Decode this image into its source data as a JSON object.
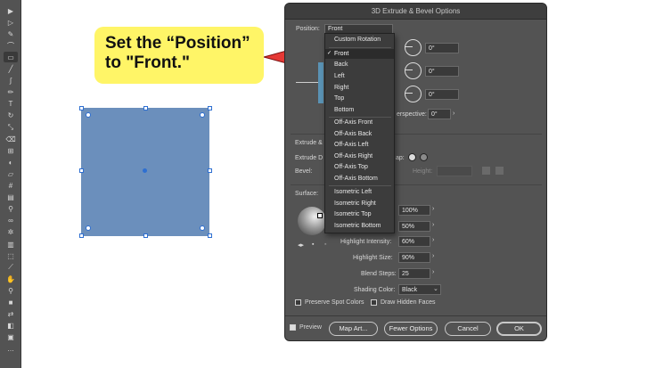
{
  "callout": {
    "line1": "Set the “Position”",
    "line2": "to \"Front.\""
  },
  "colors": {
    "shape_fill": "#6b8fbc",
    "callout_bg": "#fff567",
    "arrow": "#e53935",
    "dialog_bg": "#535353"
  },
  "dialog": {
    "title": "3D Extrude & Bevel Options",
    "position_label": "Position:",
    "position_value": "Front",
    "rotation": [
      "0°",
      "0°",
      "0°"
    ],
    "perspective_label": "erspective:",
    "perspective_value": "0°",
    "extrude_section": "Extrude &",
    "extrude_depth_label": "Extrude D",
    "cap_label": "ap:",
    "bevel_label": "Bevel:",
    "height_label": "Height:",
    "surface_label": "Surface:",
    "light_intensity_value": "100%",
    "ambient_light_value": "50%",
    "highlight_intensity_label": "Highlight Intensity:",
    "highlight_intensity_value": "60%",
    "highlight_size_label": "Highlight Size:",
    "highlight_size_value": "90%",
    "blend_steps_label": "Blend Steps:",
    "blend_steps_value": "25",
    "shading_color_label": "Shading Color:",
    "shading_color_value": "Black",
    "preserve_spot_label": "Preserve Spot Colors",
    "draw_hidden_label": "Draw Hidden Faces",
    "preview_label": "Preview",
    "map_art_label": "Map Art...",
    "fewer_options_label": "Fewer Options",
    "cancel_label": "Cancel",
    "ok_label": "OK"
  },
  "menu": {
    "items_group1": [
      "Custom Rotation"
    ],
    "selected": "Front",
    "items_group2": [
      "Back",
      "Left",
      "Right",
      "Top",
      "Bottom"
    ],
    "items_group3": [
      "Off-Axis Front",
      "Off-Axis Back",
      "Off-Axis Left",
      "Off-Axis Right",
      "Off-Axis Top",
      "Off-Axis Bottom"
    ],
    "items_group4": [
      "Isometric Left",
      "Isometric Right",
      "Isometric Top",
      "Isometric Bottom"
    ]
  }
}
